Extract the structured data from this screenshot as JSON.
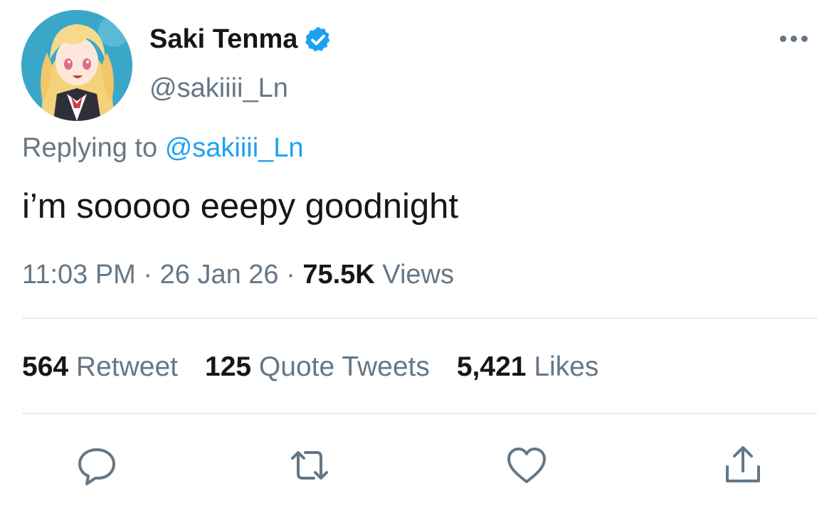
{
  "author": {
    "display_name": "Saki Tenma",
    "handle": "@sakiiii_Ln",
    "verified_icon": "verified-badge-icon",
    "avatar": "anime-girl-avatar"
  },
  "reply": {
    "prefix": "Replying to",
    "mention": "@sakiiii_Ln"
  },
  "tweet": {
    "text": "i’m sooooo eeepy goodnight"
  },
  "meta": {
    "time": "11:03 PM",
    "separator1": "·",
    "date": "26 Jan 26",
    "separator2": "·",
    "views_count": "75.5K",
    "views_label": "Views"
  },
  "stats": {
    "retweets_count": "564",
    "retweets_label": "Retweet",
    "quotes_count": "125",
    "quotes_label": "Quote Tweets",
    "likes_count": "5,421",
    "likes_label": "Likes"
  },
  "actions": {
    "reply_icon": "reply-icon",
    "retweet_icon": "retweet-icon",
    "like_icon": "heart-icon",
    "share_icon": "share-icon"
  },
  "colors": {
    "accent": "#1da1f2",
    "muted": "#657786",
    "text": "#14171a",
    "divider": "#e6ecf0"
  }
}
